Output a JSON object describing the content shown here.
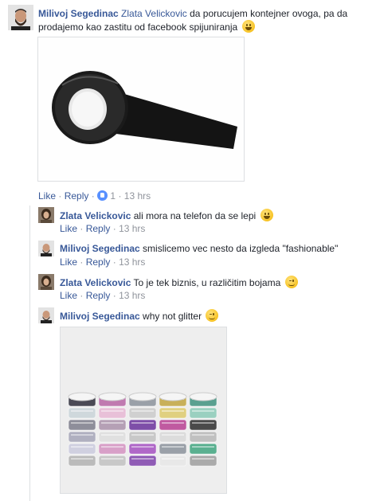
{
  "comments": [
    {
      "author": "Milivoj Segedinac",
      "tag": "Zlata Velickovic",
      "text_line1": " da porucujem kontejner ovoga, pa da",
      "text_line2": "prodajemo kao zastitu od facebook spijuniranja",
      "emoji": "grinning-emoji",
      "actions": {
        "like": "Like",
        "reply": "Reply",
        "reactions": "1",
        "time": "13 hrs"
      },
      "photo": "black duct tape roll"
    }
  ],
  "replies": [
    {
      "author": "Zlata Velickovic",
      "text": "ali mora na telefon da se lepi",
      "emoji": "grinning-emoji",
      "actions": {
        "like": "Like",
        "reply": "Reply",
        "time": "13 hrs"
      }
    },
    {
      "author": "Milivoj Segedinac",
      "text": "smislicemo vec nesto da izgleda \"fashionable\"",
      "actions": {
        "like": "Like",
        "reply": "Reply",
        "time": "13 hrs"
      }
    },
    {
      "author": "Zlata Velickovic",
      "text": "To je tek biznis, u različitim bojama",
      "emoji": "winking-emoji",
      "actions": {
        "like": "Like",
        "reply": "Reply",
        "time": "13 hrs"
      }
    },
    {
      "author": "Milivoj Segedinac",
      "text": "why not glitter",
      "emoji": "winking-emoji",
      "photo": "glitter washi tapes"
    }
  ],
  "separator": "·",
  "colors": {
    "link": "#385898",
    "meta": "#90949c",
    "like_badge": "#5890ff"
  }
}
